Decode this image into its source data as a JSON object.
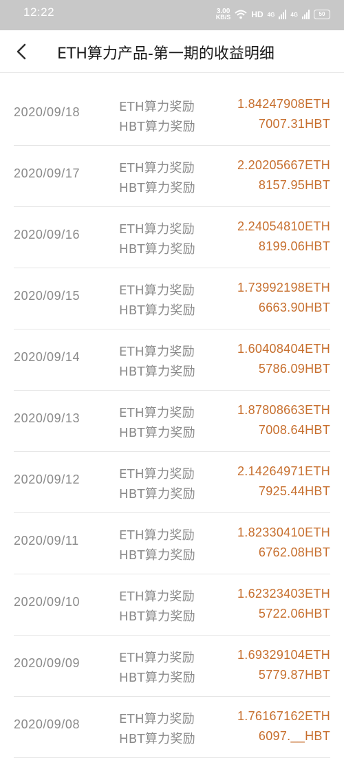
{
  "status_bar": {
    "time": "12:22",
    "net_speed_value": "3.00",
    "net_speed_unit": "KB/S",
    "hd_label": "HD",
    "signal_label_1": "4G",
    "signal_label_2": "4G",
    "battery": "50"
  },
  "header": {
    "title": "ETH算力产品-第一期的收益明细"
  },
  "labels": {
    "eth_reward": "ETH算力奖励",
    "hbt_reward": "HBT算力奖励"
  },
  "rows": [
    {
      "date": "2020/09/18",
      "eth": "1.84247908ETH",
      "hbt": "7007.31HBT"
    },
    {
      "date": "2020/09/17",
      "eth": "2.20205667ETH",
      "hbt": "8157.95HBT"
    },
    {
      "date": "2020/09/16",
      "eth": "2.24054810ETH",
      "hbt": "8199.06HBT"
    },
    {
      "date": "2020/09/15",
      "eth": "1.73992198ETH",
      "hbt": "6663.90HBT"
    },
    {
      "date": "2020/09/14",
      "eth": "1.60408404ETH",
      "hbt": "5786.09HBT"
    },
    {
      "date": "2020/09/13",
      "eth": "1.87808663ETH",
      "hbt": "7008.64HBT"
    },
    {
      "date": "2020/09/12",
      "eth": "2.14264971ETH",
      "hbt": "7925.44HBT"
    },
    {
      "date": "2020/09/11",
      "eth": "1.82330410ETH",
      "hbt": "6762.08HBT"
    },
    {
      "date": "2020/09/10",
      "eth": "1.62323403ETH",
      "hbt": "5722.06HBT"
    },
    {
      "date": "2020/09/09",
      "eth": "1.69329104ETH",
      "hbt": "5779.87HBT"
    },
    {
      "date": "2020/09/08",
      "eth": "1.76167162ETH",
      "hbt": "6097.__HBT"
    }
  ]
}
